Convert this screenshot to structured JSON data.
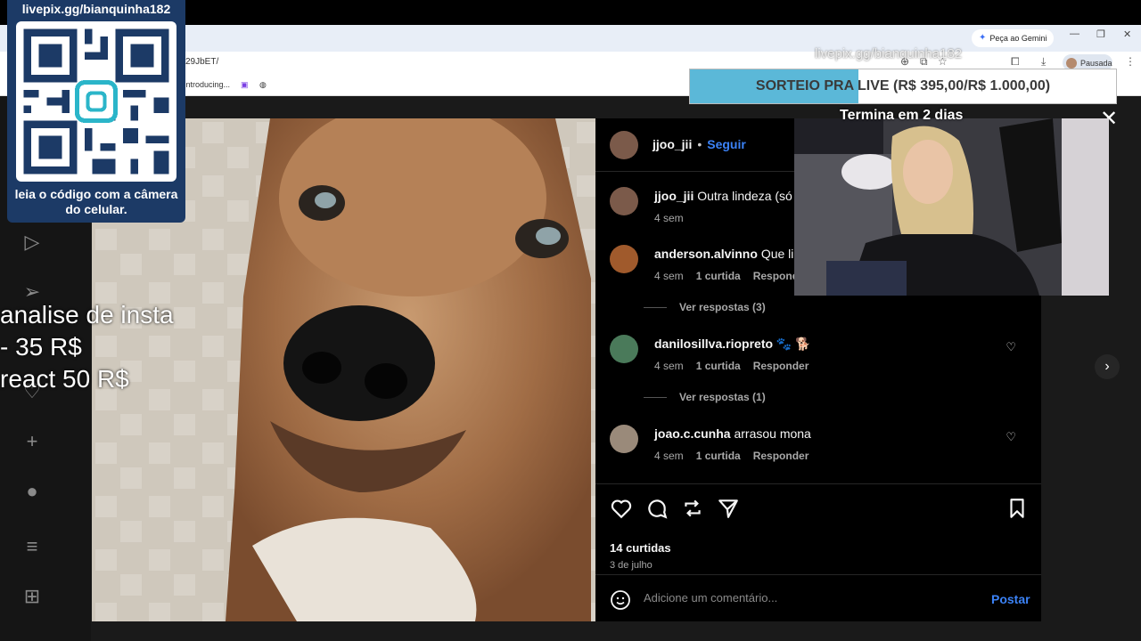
{
  "browser": {
    "gemini_label": "Peça ao Gemini",
    "url_text": "29JbET/",
    "profile_label": "Pausada",
    "bookmark_1": "Introducing..."
  },
  "post": {
    "header": {
      "username": "jjoo_jii",
      "separator": "•",
      "follow_label": "Seguir"
    },
    "comments": [
      {
        "username": "jjoo_jii",
        "text": "Outra lindeza (só r",
        "time": "4 sem",
        "likes": "",
        "reply": ""
      },
      {
        "username": "anderson.alvinno",
        "text": "Que lin",
        "time": "4 sem",
        "likes": "1 curtida",
        "reply": "Responde",
        "view_replies": "Ver respostas (3)"
      },
      {
        "username": "danilosillva.riopreto",
        "text": "🐾 🐕",
        "time": "4 sem",
        "likes": "1 curtida",
        "reply": "Responder",
        "view_replies": "Ver respostas (1)"
      },
      {
        "username": "joao.c.cunha",
        "text": "arrasou mona",
        "time": "4 sem",
        "likes": "1 curtida",
        "reply": "Responder"
      }
    ],
    "likes_count": "14 curtidas",
    "date": "3 de julho",
    "comment_placeholder": "Adicione um comentário...",
    "post_button": "Postar"
  },
  "overlay": {
    "qr_title": "livepix.gg/bianquinha182",
    "qr_caption": "leia o código com a câmera do celular.",
    "price_text": "analise de insta\n- 35 R$\nreact 50 R$",
    "watermark": "livepix.gg/bianquinha182",
    "sorteio_text": "SORTEIO PRA LIVE (R$ 395,00/R$ 1.000,00)",
    "sorteio_progress": 0.395,
    "termina_text": "Termina em 2 dias"
  },
  "colors": {
    "accent_blue": "#3b82f6",
    "overlay_navy": "#1c3a66",
    "progress_blue": "#5bb8d8"
  }
}
